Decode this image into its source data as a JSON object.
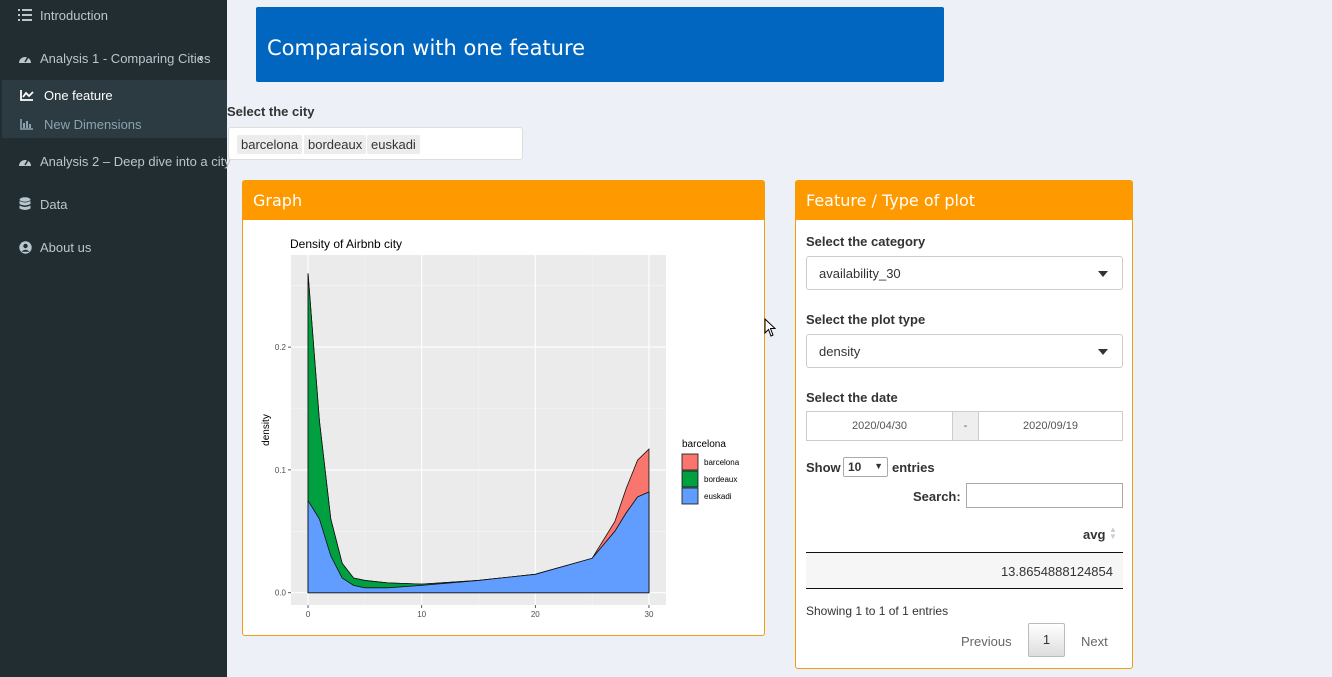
{
  "sidebar": {
    "items": [
      {
        "label": "Introduction",
        "icon": "list-icon"
      },
      {
        "label": "Analysis 1 - Comparing Cities",
        "icon": "dashboard-icon"
      },
      {
        "label": "Analysis 2 – Deep dive into a city",
        "icon": "dashboard-icon"
      },
      {
        "label": "Data",
        "icon": "database-icon"
      },
      {
        "label": "About us",
        "icon": "user-circle-icon"
      }
    ],
    "subitems": [
      {
        "label": "One feature",
        "icon": "line-chart-icon"
      },
      {
        "label": "New Dimensions",
        "icon": "bar-chart-icon"
      }
    ]
  },
  "header": {
    "title": "Comparaison with one feature"
  },
  "city_select": {
    "label": "Select the city",
    "chips": [
      "barcelona",
      "bordeaux",
      "euskadi"
    ]
  },
  "graph_box": {
    "title": "Graph"
  },
  "feature_box": {
    "title": "Feature / Type of plot",
    "category_label": "Select the category",
    "category_value": "availability_30",
    "plot_type_label": "Select the plot type",
    "plot_type_value": "density",
    "date_label": "Select the date",
    "date_start": "2020/04/30",
    "date_sep": "-",
    "date_end": "2020/09/19",
    "show_label": "Show",
    "show_value": "10",
    "entries_label": "entries",
    "search_label": "Search:",
    "table": {
      "column": "avg",
      "rows": [
        [
          "13.8654888124854"
        ]
      ]
    },
    "info": "Showing 1 to 1 of 1 entries",
    "prev": "Previous",
    "page": "1",
    "next": "Next"
  },
  "colors": {
    "barcelona": "#f8766d",
    "bordeaux": "#00a040",
    "euskadi": "#619cff",
    "header_blue": "#0066c0",
    "box_orange": "#ff9900"
  },
  "chart_data": {
    "type": "area",
    "title": "Density of Airbnb city",
    "xlabel": "",
    "ylabel": "density",
    "xlim": [
      -1.5,
      31.5
    ],
    "ylim": [
      -0.01,
      0.275
    ],
    "xticks": [
      0,
      10,
      20,
      30
    ],
    "yticks": [
      0.0,
      0.1,
      0.2
    ],
    "ytick_labels": [
      "0.0",
      "0.1",
      "0.2"
    ],
    "legend_title": "barcelona",
    "legend_position": "right",
    "stacked": true,
    "x": [
      0,
      1,
      2,
      3,
      4,
      5,
      7,
      10,
      15,
      20,
      25,
      27,
      28,
      29,
      30
    ],
    "series": [
      {
        "name": "barcelona",
        "color": "#f8766d",
        "values": [
          0,
          0,
          0,
          0,
          0,
          0,
          0,
          0,
          0,
          0,
          0,
          0.008,
          0.02,
          0.03,
          0.035
        ]
      },
      {
        "name": "bordeaux",
        "color": "#00a040",
        "values": [
          0.185,
          0.08,
          0.03,
          0.012,
          0.006,
          0.006,
          0.004,
          0.001,
          0,
          0,
          0,
          0,
          0,
          0,
          0
        ]
      },
      {
        "name": "euskadi",
        "color": "#619cff",
        "values": [
          0.075,
          0.06,
          0.03,
          0.012,
          0.006,
          0.004,
          0.004,
          0.006,
          0.01,
          0.015,
          0.028,
          0.05,
          0.065,
          0.078,
          0.082
        ]
      }
    ]
  }
}
